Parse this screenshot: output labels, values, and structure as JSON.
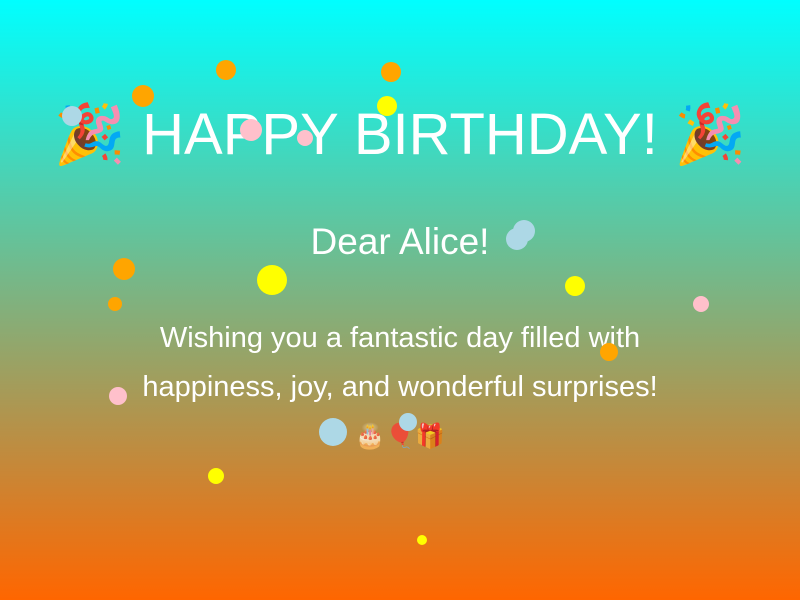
{
  "card": {
    "title": "🎉 HAPPY BIRTHDAY! 🎉",
    "greeting": "Dear Alice!",
    "message_line1": "Wishing you a fantastic day filled with",
    "message_line2": "happiness, joy, and wonderful surprises!",
    "emojis": "🎂🎈🎁"
  },
  "colors": {
    "gradient_top": "#00ffff",
    "gradient_bottom": "#ff6600",
    "confetti": [
      "#ffa500",
      "#ffff00",
      "#ffc0cb",
      "#add8e6"
    ]
  }
}
